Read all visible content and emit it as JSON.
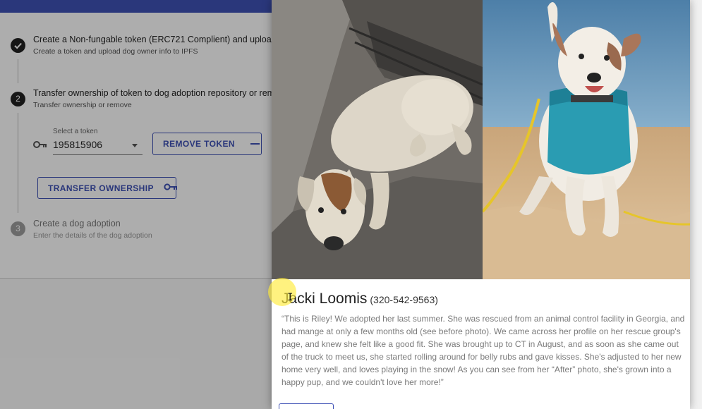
{
  "stepper": {
    "step1": {
      "title": "Create a Non-fungable token (ERC721 Complient) and upload d",
      "subtitle": "Create a token and upload dog owner info to IPFS"
    },
    "step2": {
      "number": "2",
      "title": "Transfer ownership of token to dog adoption repository or remo",
      "subtitle": "Transfer ownership or remove",
      "select_label": "Select a token",
      "select_value": "195815906",
      "remove_label": "REMOVE TOKEN",
      "transfer_label": "TRANSFER OWNERSHIP"
    },
    "step3": {
      "number": "3",
      "title": "Create a dog adoption",
      "subtitle": "Enter the details of the dog adoption"
    }
  },
  "modal": {
    "owner_name": "Jacki Loomis",
    "owner_phone": "(320-542-9563)",
    "story": "“This is Riley! We adopted her last summer. She was rescued from an animal control facility in Georgia, and had mange at only a few months old (see before photo). We came across her profile on her rescue group's page, and knew she felt like a good fit. She was brought up to CT in August, and as soon as she came out of the truck to meet us, she started rolling around for belly rubs and gave kisses. She's adjusted to her new home very well, and loves playing in the snow! As you can see from her “After” photo, she's grown into a happy pup, and we couldn't love her more!”"
  },
  "colors": {
    "primary": "#3f51b5",
    "step_active": "#212121",
    "step_inactive": "#9e9e9e",
    "cursor_highlight": "#ffeb3b"
  },
  "icons": [
    "check-icon",
    "key-icon",
    "minus-icon",
    "chevron-down-icon",
    "text-cursor-icon"
  ]
}
